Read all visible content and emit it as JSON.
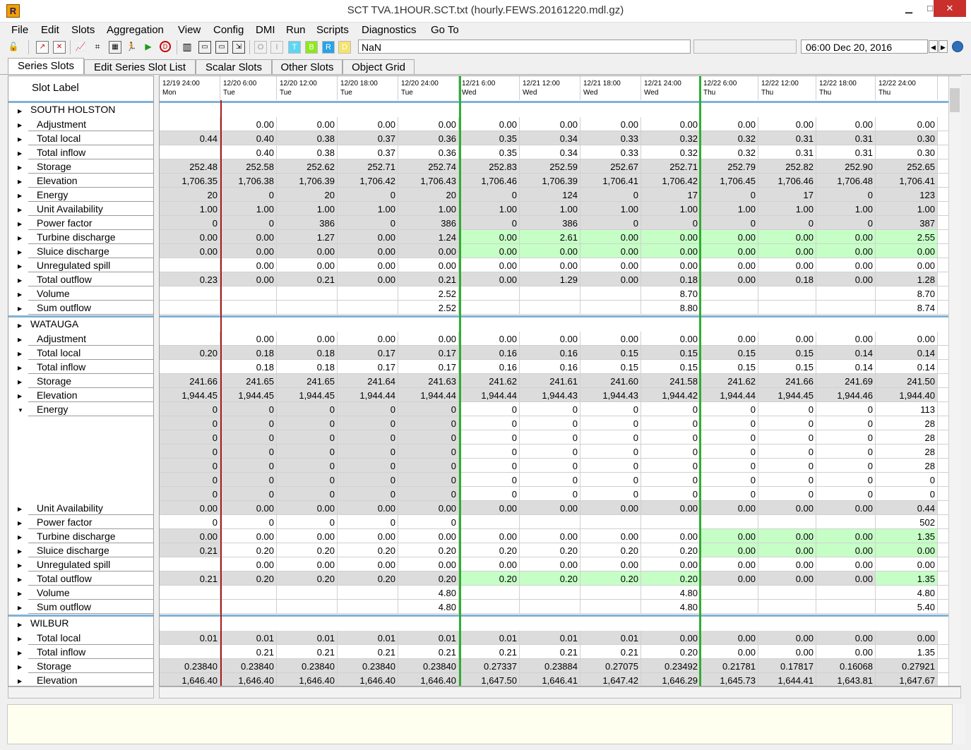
{
  "window": {
    "title": "SCT TVA.1HOUR.SCT.txt (hourly.FEWS.20161220.mdl.gz)",
    "minimize": "▁",
    "maximize": "□",
    "close": "✕"
  },
  "menu": [
    "File",
    "Edit",
    "Slots",
    "Aggregation",
    "View",
    "Config",
    "DMI",
    "Run",
    "Scripts",
    "Diagnostics",
    "Go To"
  ],
  "toolbar": {
    "value_field": "NaN",
    "datetime": "06:00 Dec 20, 2016",
    "flag_buttons": [
      "O",
      "I",
      "T",
      "B",
      "R",
      "D"
    ],
    "icons": [
      "unlock-icon",
      "edit-slot-icon",
      "delete-slot-icon",
      "plot-icon",
      "tree-icon",
      "calendar-icon",
      "runner-icon",
      "run-icon",
      "stop-icon",
      "bars-icon",
      "save-icon",
      "save-as-icon",
      "fit-icon"
    ]
  },
  "tabs": [
    "Series Slots",
    "Edit Series Slot List",
    "Scalar Slots",
    "Other Slots",
    "Object Grid"
  ],
  "active_tab": 0,
  "slot_label_header": "Slot Label",
  "colors": {
    "bar_blue": "#7fb2d6",
    "gray_cell": "#dcdcdc",
    "green_cell": "#c6ffc6",
    "red_line": "#a81b1b",
    "green_line": "#2fae2f"
  },
  "columns": [
    {
      "date": "12/19 24:00",
      "day": "Mon"
    },
    {
      "date": "12/20 6:00",
      "day": "Tue"
    },
    {
      "date": "12/20 12:00",
      "day": "Tue"
    },
    {
      "date": "12/20 18:00",
      "day": "Tue"
    },
    {
      "date": "12/20 24:00",
      "day": "Tue"
    },
    {
      "date": "12/21 6:00",
      "day": "Wed"
    },
    {
      "date": "12/21 12:00",
      "day": "Wed"
    },
    {
      "date": "12/21 18:00",
      "day": "Wed"
    },
    {
      "date": "12/21 24:00",
      "day": "Wed"
    },
    {
      "date": "12/22 6:00",
      "day": "Thu"
    },
    {
      "date": "12/22 12:00",
      "day": "Thu"
    },
    {
      "date": "12/22 18:00",
      "day": "Thu"
    },
    {
      "date": "12/22 24:00",
      "day": "Thu"
    }
  ],
  "rows": [
    {
      "t": "o",
      "label": "SOUTH HOLSTON"
    },
    {
      "t": "s",
      "label": "Adjustment",
      "v": [
        "",
        "0.00",
        "0.00",
        "0.00",
        "0.00",
        "0.00",
        "0.00",
        "0.00",
        "0.00",
        "0.00",
        "0.00",
        "0.00",
        "0.00"
      ]
    },
    {
      "t": "s",
      "label": "Total local",
      "g": 1,
      "v": [
        "0.44",
        "0.40",
        "0.38",
        "0.37",
        "0.36",
        "0.35",
        "0.34",
        "0.33",
        "0.32",
        "0.32",
        "0.31",
        "0.31",
        "0.30"
      ]
    },
    {
      "t": "s",
      "label": "Total inflow",
      "v": [
        "",
        "0.40",
        "0.38",
        "0.37",
        "0.36",
        "0.35",
        "0.34",
        "0.33",
        "0.32",
        "0.32",
        "0.31",
        "0.31",
        "0.30"
      ]
    },
    {
      "t": "s",
      "label": "Storage",
      "g": 1,
      "v": [
        "252.48",
        "252.58",
        "252.62",
        "252.71",
        "252.74",
        "252.83",
        "252.59",
        "252.67",
        "252.71",
        "252.79",
        "252.82",
        "252.90",
        "252.65"
      ]
    },
    {
      "t": "s",
      "label": "Elevation",
      "g": 1,
      "v": [
        "1,706.35",
        "1,706.38",
        "1,706.39",
        "1,706.42",
        "1,706.43",
        "1,706.46",
        "1,706.39",
        "1,706.41",
        "1,706.42",
        "1,706.45",
        "1,706.46",
        "1,706.48",
        "1,706.41"
      ]
    },
    {
      "t": "s",
      "label": "Energy",
      "g": 1,
      "v": [
        "20",
        "0",
        "20",
        "0",
        "20",
        "0",
        "124",
        "0",
        "17",
        "0",
        "17",
        "0",
        "123"
      ]
    },
    {
      "t": "s",
      "label": "Unit Availability",
      "g": 1,
      "v": [
        "1.00",
        "1.00",
        "1.00",
        "1.00",
        "1.00",
        "1.00",
        "1.00",
        "1.00",
        "1.00",
        "1.00",
        "1.00",
        "1.00",
        "1.00"
      ]
    },
    {
      "t": "s",
      "label": "Power  factor",
      "g": 1,
      "v": [
        "0",
        "0",
        "386",
        "0",
        "386",
        "0",
        "386",
        "0",
        "0",
        "0",
        "0",
        "0",
        "387"
      ]
    },
    {
      "t": "s",
      "label": "Turbine discharge",
      "g": 1,
      "gr": [
        5,
        6,
        7,
        8,
        9,
        10,
        11,
        12
      ],
      "v": [
        "0.00",
        "0.00",
        "1.27",
        "0.00",
        "1.24",
        "0.00",
        "2.61",
        "0.00",
        "0.00",
        "0.00",
        "0.00",
        "0.00",
        "2.55"
      ]
    },
    {
      "t": "s",
      "label": "Sluice discharge",
      "g": 1,
      "gr": [
        5,
        6,
        7,
        8,
        9,
        10,
        11,
        12
      ],
      "v": [
        "0.00",
        "0.00",
        "0.00",
        "0.00",
        "0.00",
        "0.00",
        "0.00",
        "0.00",
        "0.00",
        "0.00",
        "0.00",
        "0.00",
        "0.00"
      ]
    },
    {
      "t": "s",
      "label": "Unregulated spill",
      "v": [
        "",
        "0.00",
        "0.00",
        "0.00",
        "0.00",
        "0.00",
        "0.00",
        "0.00",
        "0.00",
        "0.00",
        "0.00",
        "0.00",
        "0.00"
      ]
    },
    {
      "t": "s",
      "label": "Total outflow",
      "g": 1,
      "v": [
        "0.23",
        "0.00",
        "0.21",
        "0.00",
        "0.21",
        "0.00",
        "1.29",
        "0.00",
        "0.18",
        "0.00",
        "0.18",
        "0.00",
        "1.28"
      ]
    },
    {
      "t": "s",
      "label": "Volume",
      "v": [
        "",
        "",
        "",
        "",
        "2.52",
        "",
        "",
        "",
        "8.70",
        "",
        "",
        "",
        "8.70"
      ]
    },
    {
      "t": "s",
      "label": "Sum outflow",
      "v": [
        "",
        "",
        "",
        "",
        "2.52",
        "",
        "",
        "",
        "8.80",
        "",
        "",
        "",
        "8.74"
      ]
    },
    {
      "t": "o",
      "label": "WATAUGA"
    },
    {
      "t": "s",
      "label": "Adjustment",
      "v": [
        "",
        "0.00",
        "0.00",
        "0.00",
        "0.00",
        "0.00",
        "0.00",
        "0.00",
        "0.00",
        "0.00",
        "0.00",
        "0.00",
        "0.00"
      ]
    },
    {
      "t": "s",
      "label": "Total local",
      "g": 1,
      "v": [
        "0.20",
        "0.18",
        "0.18",
        "0.17",
        "0.17",
        "0.16",
        "0.16",
        "0.15",
        "0.15",
        "0.15",
        "0.15",
        "0.14",
        "0.14"
      ]
    },
    {
      "t": "s",
      "label": "Total inflow",
      "v": [
        "",
        "0.18",
        "0.18",
        "0.17",
        "0.17",
        "0.16",
        "0.16",
        "0.15",
        "0.15",
        "0.15",
        "0.15",
        "0.14",
        "0.14"
      ]
    },
    {
      "t": "s",
      "label": "Storage",
      "g": 1,
      "v": [
        "241.66",
        "241.65",
        "241.65",
        "241.64",
        "241.63",
        "241.62",
        "241.61",
        "241.60",
        "241.58",
        "241.62",
        "241.66",
        "241.69",
        "241.50"
      ]
    },
    {
      "t": "s",
      "label": "Elevation",
      "g": 1,
      "v": [
        "1,944.45",
        "1,944.45",
        "1,944.45",
        "1,944.44",
        "1,944.44",
        "1,944.44",
        "1,944.43",
        "1,944.43",
        "1,944.42",
        "1,944.44",
        "1,944.45",
        "1,944.46",
        "1,944.40"
      ]
    },
    {
      "t": "s",
      "label": "Energy",
      "exp": 1,
      "g": 1,
      "gl": 5,
      "v": [
        "0",
        "0",
        "0",
        "0",
        "0",
        "0",
        "0",
        "0",
        "0",
        "0",
        "0",
        "0",
        "113"
      ]
    },
    {
      "t": "x",
      "gl": 5,
      "v": [
        "0",
        "0",
        "0",
        "0",
        "0",
        "0",
        "0",
        "0",
        "0",
        "0",
        "0",
        "0",
        "28"
      ]
    },
    {
      "t": "x",
      "gl": 5,
      "v": [
        "0",
        "0",
        "0",
        "0",
        "0",
        "0",
        "0",
        "0",
        "0",
        "0",
        "0",
        "0",
        "28"
      ]
    },
    {
      "t": "x",
      "gl": 5,
      "v": [
        "0",
        "0",
        "0",
        "0",
        "0",
        "0",
        "0",
        "0",
        "0",
        "0",
        "0",
        "0",
        "28"
      ]
    },
    {
      "t": "x",
      "gl": 5,
      "v": [
        "0",
        "0",
        "0",
        "0",
        "0",
        "0",
        "0",
        "0",
        "0",
        "0",
        "0",
        "0",
        "28"
      ]
    },
    {
      "t": "x",
      "gl": 5,
      "v": [
        "0",
        "0",
        "0",
        "0",
        "0",
        "0",
        "0",
        "0",
        "0",
        "0",
        "0",
        "0",
        "0"
      ]
    },
    {
      "t": "x",
      "gl": 5,
      "v": [
        "0",
        "0",
        "0",
        "0",
        "0",
        "0",
        "0",
        "0",
        "0",
        "0",
        "0",
        "0",
        "0"
      ]
    },
    {
      "t": "s",
      "label": "Unit Availability",
      "g": 1,
      "v": [
        "0.00",
        "0.00",
        "0.00",
        "0.00",
        "0.00",
        "0.00",
        "0.00",
        "0.00",
        "0.00",
        "0.00",
        "0.00",
        "0.00",
        "0.44"
      ]
    },
    {
      "t": "s",
      "label": "Power factor",
      "v": [
        "0",
        "0",
        "0",
        "0",
        "0",
        "",
        "",
        "",
        "",
        "",
        "",
        "",
        "502"
      ]
    },
    {
      "t": "s",
      "label": "Turbine discharge",
      "v": [
        "0.00",
        "0.00",
        "0.00",
        "0.00",
        "0.00",
        "0.00",
        "0.00",
        "0.00",
        "0.00",
        "0.00",
        "0.00",
        "0.00",
        "1.35"
      ],
      "gr": [
        9,
        10,
        11,
        12
      ],
      "gl": 1
    },
    {
      "t": "s",
      "label": "Sluice discharge",
      "gl": 1,
      "gr": [
        9,
        10,
        11,
        12
      ],
      "v": [
        "0.21",
        "0.20",
        "0.20",
        "0.20",
        "0.20",
        "0.20",
        "0.20",
        "0.20",
        "0.20",
        "0.00",
        "0.00",
        "0.00",
        "0.00"
      ]
    },
    {
      "t": "s",
      "label": "Unregulated spill",
      "v": [
        "",
        "0.00",
        "0.00",
        "0.00",
        "0.00",
        "0.00",
        "0.00",
        "0.00",
        "0.00",
        "0.00",
        "0.00",
        "0.00",
        "0.00"
      ]
    },
    {
      "t": "s",
      "label": "Total outflow",
      "g": 1,
      "gr": [
        5,
        6,
        7,
        8,
        12
      ],
      "v": [
        "0.21",
        "0.20",
        "0.20",
        "0.20",
        "0.20",
        "0.20",
        "0.20",
        "0.20",
        "0.20",
        "0.00",
        "0.00",
        "0.00",
        "1.35"
      ]
    },
    {
      "t": "s",
      "label": "Volume",
      "v": [
        "",
        "",
        "",
        "",
        "4.80",
        "",
        "",
        "",
        "4.80",
        "",
        "",
        "",
        "4.80"
      ]
    },
    {
      "t": "s",
      "label": "Sum outflow",
      "v": [
        "",
        "",
        "",
        "",
        "4.80",
        "",
        "",
        "",
        "4.80",
        "",
        "",
        "",
        "5.40"
      ]
    },
    {
      "t": "o",
      "label": "WILBUR"
    },
    {
      "t": "s",
      "label": "Total local",
      "g": 1,
      "v": [
        "0.01",
        "0.01",
        "0.01",
        "0.01",
        "0.01",
        "0.01",
        "0.01",
        "0.01",
        "0.00",
        "0.00",
        "0.00",
        "0.00",
        "0.00"
      ]
    },
    {
      "t": "s",
      "label": "Total inflow",
      "v": [
        "",
        "0.21",
        "0.21",
        "0.21",
        "0.21",
        "0.21",
        "0.21",
        "0.21",
        "0.20",
        "0.00",
        "0.00",
        "0.00",
        "1.35"
      ]
    },
    {
      "t": "s",
      "label": "Storage",
      "g": 1,
      "v": [
        "0.23840",
        "0.23840",
        "0.23840",
        "0.23840",
        "0.23840",
        "0.27337",
        "0.23884",
        "0.27075",
        "0.23492",
        "0.21781",
        "0.17817",
        "0.16068",
        "0.27921"
      ]
    },
    {
      "t": "s",
      "label": "Elevation",
      "g": 1,
      "v": [
        "1,646.40",
        "1,646.40",
        "1,646.40",
        "1,646.40",
        "1,646.40",
        "1,647.50",
        "1,646.41",
        "1,647.42",
        "1,646.29",
        "1,645.73",
        "1,644.41",
        "1,643.81",
        "1,647.67"
      ]
    }
  ]
}
